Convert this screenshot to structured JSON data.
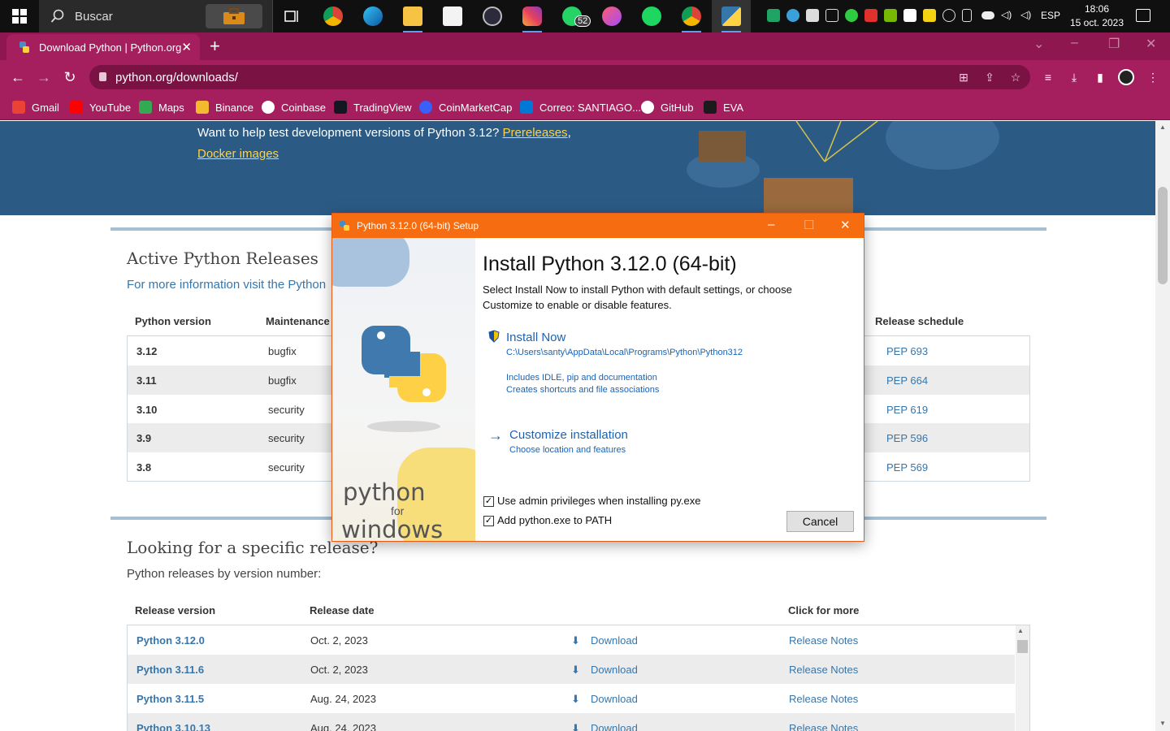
{
  "taskbar": {
    "search_placeholder": "Buscar",
    "whatsapp_badge": "52",
    "language": "ESP",
    "time": "18:06",
    "date": "15 oct. 2023"
  },
  "browser": {
    "tab_title": "Download Python | Python.org",
    "url": "python.org/downloads/",
    "bookmarks": [
      "Gmail",
      "YouTube",
      "Maps",
      "Binance",
      "Coinbase",
      "TradingView",
      "CoinMarketCap",
      "Correo: SANTIAGO...",
      "GitHub",
      "EVA"
    ]
  },
  "page": {
    "banner_text": "Want to help test development versions of Python 3.12?",
    "banner_link_prereleases": "Prereleases",
    "banner_comma": ",",
    "banner_link_docker": "Docker images",
    "active_title": "Active Python Releases",
    "active_subtitle": "For more information visit the Python",
    "active_headers": {
      "version": "Python version",
      "maintenance": "Maintenance",
      "schedule": "Release schedule"
    },
    "active_rows": [
      {
        "version": "3.12",
        "status": "bugfix",
        "pep": "PEP 693"
      },
      {
        "version": "3.11",
        "status": "bugfix",
        "pep": "PEP 664"
      },
      {
        "version": "3.10",
        "status": "security",
        "pep": "PEP 619"
      },
      {
        "version": "3.9",
        "status": "security",
        "pep": "PEP 596"
      },
      {
        "version": "3.8",
        "status": "security",
        "pep": "PEP 569"
      }
    ],
    "specific_title": "Looking for a specific release?",
    "specific_subtitle": "Python releases by version number:",
    "release_headers": {
      "version": "Release version",
      "date": "Release date",
      "more": "Click for more"
    },
    "releases": [
      {
        "version": "Python 3.12.0",
        "date": "Oct. 2, 2023",
        "download": "Download",
        "notes": "Release Notes"
      },
      {
        "version": "Python 3.11.6",
        "date": "Oct. 2, 2023",
        "download": "Download",
        "notes": "Release Notes"
      },
      {
        "version": "Python 3.11.5",
        "date": "Aug. 24, 2023",
        "download": "Download",
        "notes": "Release Notes"
      },
      {
        "version": "Python 3.10.13",
        "date": "Aug. 24, 2023",
        "download": "Download",
        "notes": "Release Notes"
      }
    ]
  },
  "dialog": {
    "title": "Python 3.12.0 (64-bit) Setup",
    "heading": "Install Python 3.12.0 (64-bit)",
    "intro_line1": "Select Install Now to install Python with default settings, or choose",
    "intro_line2": "Customize to enable or disable features.",
    "install_now": "Install Now",
    "install_path": "C:\\Users\\santy\\AppData\\Local\\Programs\\Python\\Python312",
    "includes_line1": "Includes IDLE, pip and documentation",
    "includes_line2": "Creates shortcuts and file associations",
    "customize": "Customize installation",
    "customize_sub": "Choose location and features",
    "checkbox_admin": "Use admin privileges when installing py.exe",
    "checkbox_path": "Add python.exe to PATH",
    "checkbox_admin_checked": true,
    "checkbox_path_checked": true,
    "cancel": "Cancel",
    "side_python": "python",
    "side_for": "for",
    "side_windows": "windows"
  }
}
